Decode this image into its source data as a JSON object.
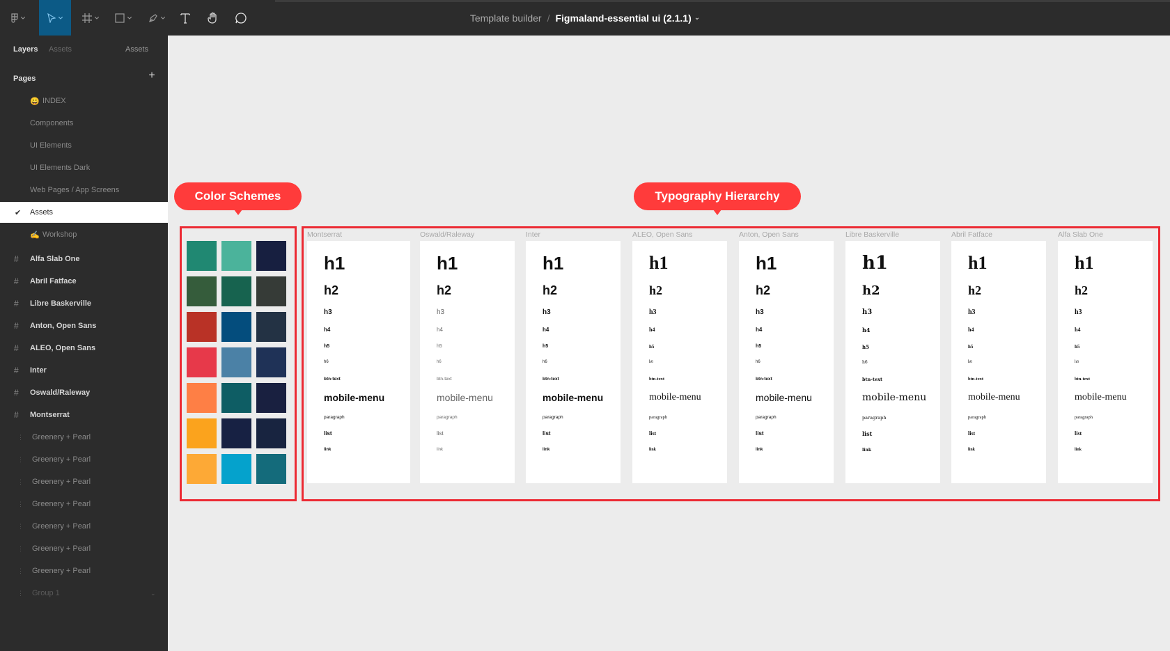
{
  "topbar": {
    "breadcrumb_project": "Template builder",
    "breadcrumb_sep": "/",
    "file_name": "Figmaland-essential ui (2.1.1)",
    "file_chevron": "⌄"
  },
  "sidebar": {
    "tabs": [
      "Layers",
      "Assets",
      "Assets"
    ],
    "pages_header": "Pages",
    "pages": [
      {
        "emoji": "😀",
        "label": "INDEX"
      },
      {
        "label": "Components"
      },
      {
        "label": "UI Elements"
      },
      {
        "label": "UI Elements Dark"
      },
      {
        "label": "Web Pages / App Screens"
      },
      {
        "label": "Assets",
        "selected": true
      },
      {
        "emoji": "✍",
        "label": "Workshop"
      }
    ],
    "layers": [
      "Alfa Slab One",
      "Abril Fatface",
      "Libre Baskerville",
      "Anton, Open Sans",
      "ALEO, Open Sans",
      "Inter",
      "Oswald/Raleway",
      "Montserrat"
    ],
    "sublayers": [
      "Greenery + Pearl",
      "Greenery + Pearl",
      "Greenery + Pearl",
      "Greenery + Pearl",
      "Greenery + Pearl",
      "Greenery + Pearl",
      "Greenery + Pearl"
    ],
    "group_label": "Group 1"
  },
  "canvas": {
    "color_pill": "Color Schemes",
    "typo_pill": "Typography Hierarchy",
    "swatches": [
      [
        "#208872",
        "#4bb39b",
        "#171f40"
      ],
      [
        "#355c3b",
        "#17634f",
        "#363b37"
      ],
      [
        "#b93226",
        "#044d7d",
        "#233244"
      ],
      [
        "#e7394a",
        "#4b81a6",
        "#1f3257"
      ],
      [
        "#fe7f45",
        "#0e5d64",
        "#192040"
      ],
      [
        "#fba31d",
        "#172143",
        "#182440"
      ],
      [
        "#fda936",
        "#05a2cc",
        "#146b7b"
      ]
    ],
    "typography": {
      "labels": [
        "Montserrat",
        "Oswald/Raleway",
        "Inter",
        "ALEO, Open Sans",
        "Anton, Open Sans",
        "Libre Baskerville",
        "Abril Fatface",
        "Alfa Slab One"
      ],
      "items": {
        "h1": "h1",
        "h2": "h2",
        "h3": "h3",
        "h4": "h4",
        "h5": "h5",
        "h6": "h6",
        "btn": "btn-text",
        "mm": "mobile-menu",
        "para": "paragraph",
        "lst": "list",
        "lnk": "link"
      }
    }
  }
}
